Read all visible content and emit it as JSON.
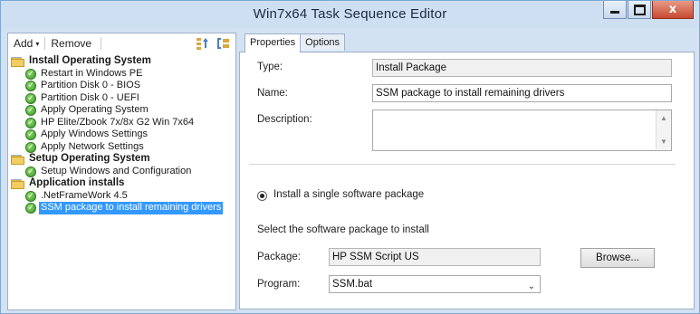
{
  "window": {
    "title": "Win7x64 Task Sequence Editor",
    "minimize_glyph": "",
    "close_glyph": "x"
  },
  "toolbar": {
    "add_label": "Add",
    "add_arrow": "▾",
    "remove_label": "Remove"
  },
  "tree": {
    "items": [
      {
        "label": "Install Operating System",
        "type": "group"
      },
      {
        "label": "Restart in Windows PE",
        "type": "step"
      },
      {
        "label": "Partition Disk 0 - BIOS",
        "type": "step"
      },
      {
        "label": "Partition Disk 0 - UEFI",
        "type": "step"
      },
      {
        "label": "Apply Operating System",
        "type": "step"
      },
      {
        "label": "HP Elite/Zbook 7x/8x G2 Win 7x64",
        "type": "step"
      },
      {
        "label": "Apply Windows Settings",
        "type": "step"
      },
      {
        "label": "Apply Network Settings",
        "type": "step"
      },
      {
        "label": "Setup Operating System",
        "type": "group"
      },
      {
        "label": "Setup Windows and Configuration",
        "type": "step"
      },
      {
        "label": "Application installs",
        "type": "group"
      },
      {
        "label": ".NetFrameWork 4.5",
        "type": "step"
      },
      {
        "label": "SSM package to install remaining drivers",
        "type": "step",
        "selected": true
      }
    ],
    "check_glyph": "✓"
  },
  "tabs": {
    "properties": "Properties",
    "options": "Options"
  },
  "form": {
    "type_label": "Type:",
    "type_value": "Install Package",
    "name_label": "Name:",
    "name_value": "SSM package to install remaining drivers",
    "description_label": "Description:",
    "description_value": "",
    "radio_label": "Install a single software package",
    "select_label": "Select the software package to install",
    "package_label": "Package:",
    "package_value": "HP SSM Script  US",
    "browse_label": "Browse...",
    "program_label": "Program:",
    "program_value": "SSM.bat"
  },
  "colors": {
    "selection": "#3399ff",
    "title_bg": "#cfdff2",
    "close_button": "#c74a32"
  }
}
